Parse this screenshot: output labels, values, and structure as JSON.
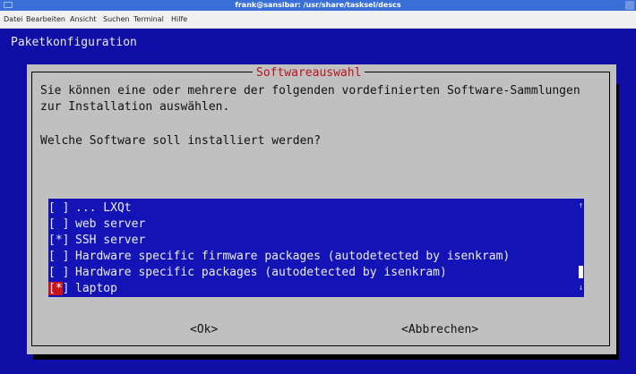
{
  "window": {
    "title": "frank@sansibar: /usr/share/tasksel/descs"
  },
  "menubar": {
    "items": [
      "Datei",
      "Bearbeiten",
      "Ansicht",
      "Suchen",
      "Terminal",
      "Hilfe"
    ]
  },
  "terminal": {
    "backtitle": "Paketkonfiguration",
    "dialog": {
      "title": "Softwareauswahl",
      "intro_line1": "Sie können eine oder mehrere der folgenden vordefinierten Software-Sammlungen",
      "intro_line2": "zur Installation auswählen.",
      "question": "Welche Software soll installiert werden?",
      "items": [
        {
          "checkbox": "[ ]",
          "label": "... LXQt"
        },
        {
          "checkbox": "[ ]",
          "label": "web server"
        },
        {
          "checkbox": "[*]",
          "label": "SSH server"
        },
        {
          "checkbox": "[ ]",
          "label": "Hardware specific firmware packages (autodetected by isenkram)"
        },
        {
          "checkbox": "[ ]",
          "label": "Hardware specific packages (autodetected by isenkram)"
        },
        {
          "checkbox_open": "[",
          "checkbox_mark": "*",
          "checkbox_close": "]",
          "label": "laptop",
          "selected": true
        }
      ],
      "scroll_up": "↑",
      "scroll_down": "↓",
      "ok_button": "<Ok>",
      "cancel_button": "<Abbrechen>"
    }
  },
  "colors": {
    "terminal_bg": "#0f0fa8",
    "dialog_bg": "#c0c0c0",
    "list_bg": "#1313b6",
    "title_red": "#b8121d",
    "selection_red": "#c8151b"
  }
}
